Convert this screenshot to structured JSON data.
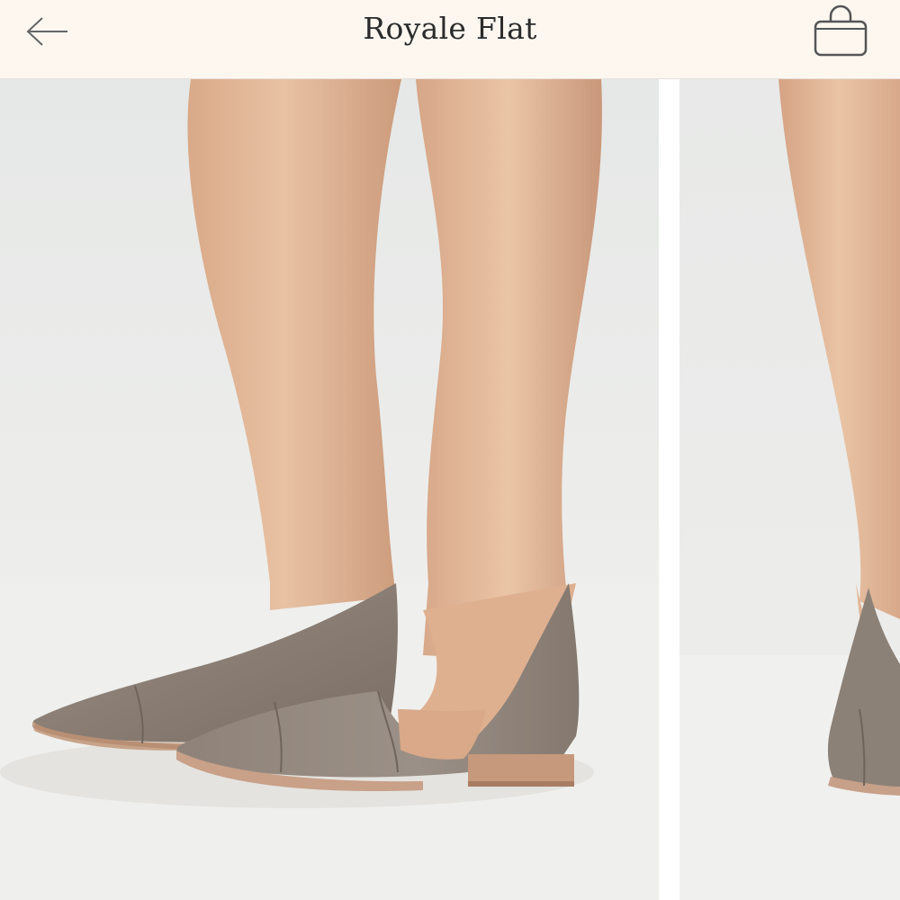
{
  "header": {
    "title": "Royale Flat",
    "back_icon": "arrow-left-icon",
    "bag_icon": "shopping-bag-icon"
  },
  "carousel": {
    "slides": [
      {
        "photo": "legs-wearing-royale-flat-front-view"
      },
      {
        "photo": "legs-wearing-royale-flat-side-view"
      }
    ]
  },
  "colors": {
    "header_bg": "#fdf7f0",
    "title_text": "#2b2b2b",
    "icon_stroke": "#555555",
    "photo_bg": "#ededeb",
    "skin": "#e2b998",
    "shoe_leather": "#8d8177",
    "sole": "#c9a088"
  }
}
